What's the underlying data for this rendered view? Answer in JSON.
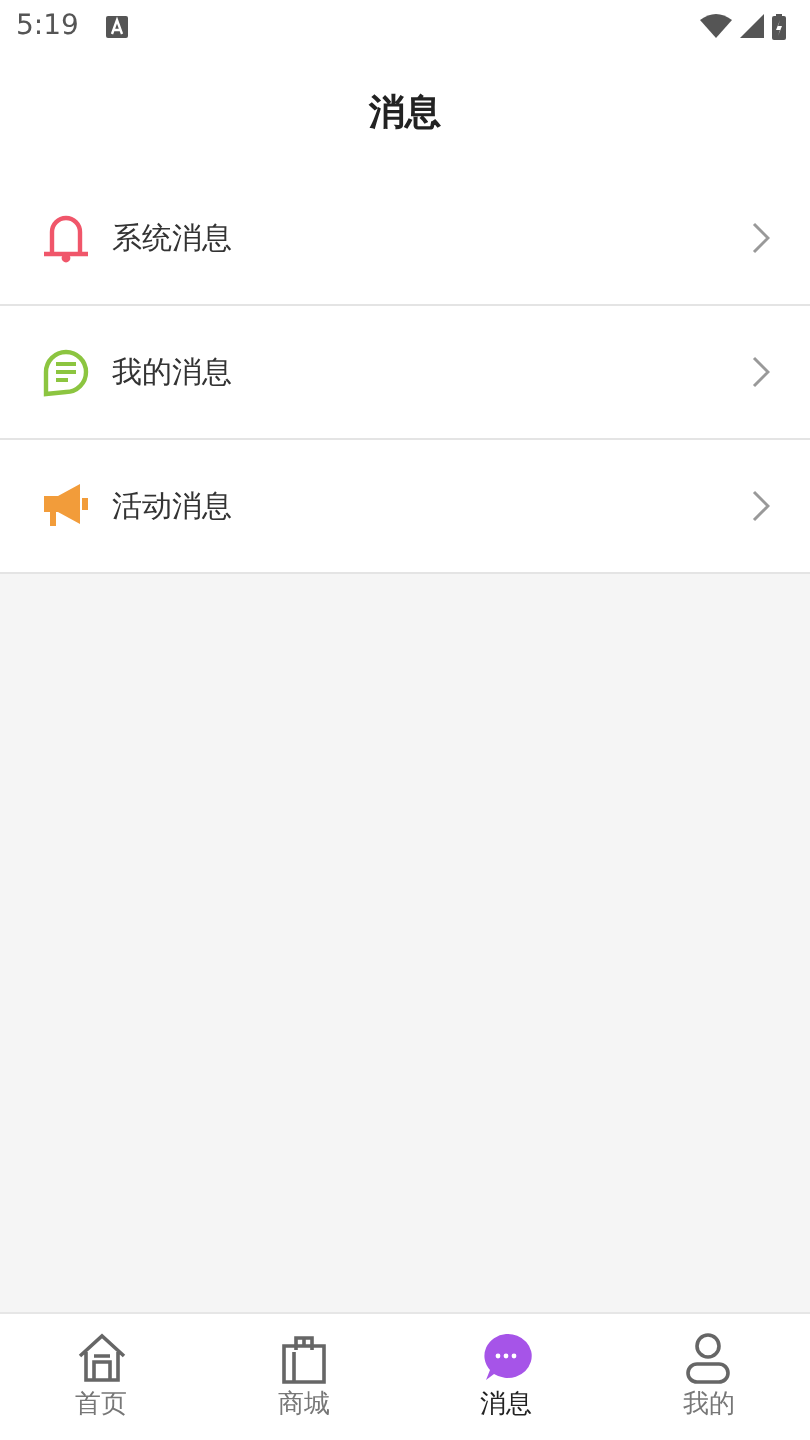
{
  "status_bar": {
    "time": "5:19"
  },
  "header": {
    "title": "消息"
  },
  "items": [
    {
      "kind": "bell",
      "label": "系统消息",
      "color": "#f0566a"
    },
    {
      "kind": "chat",
      "label": "我的消息",
      "color": "#8cc540"
    },
    {
      "kind": "megaphone",
      "label": "活动消息",
      "color": "#f29c3a"
    }
  ],
  "tabs": [
    {
      "kind": "home",
      "label": "首页",
      "selected": false
    },
    {
      "kind": "shop",
      "label": "商城",
      "selected": false
    },
    {
      "kind": "message",
      "label": "消息",
      "selected": true
    },
    {
      "kind": "user",
      "label": "我的",
      "selected": false
    }
  ]
}
